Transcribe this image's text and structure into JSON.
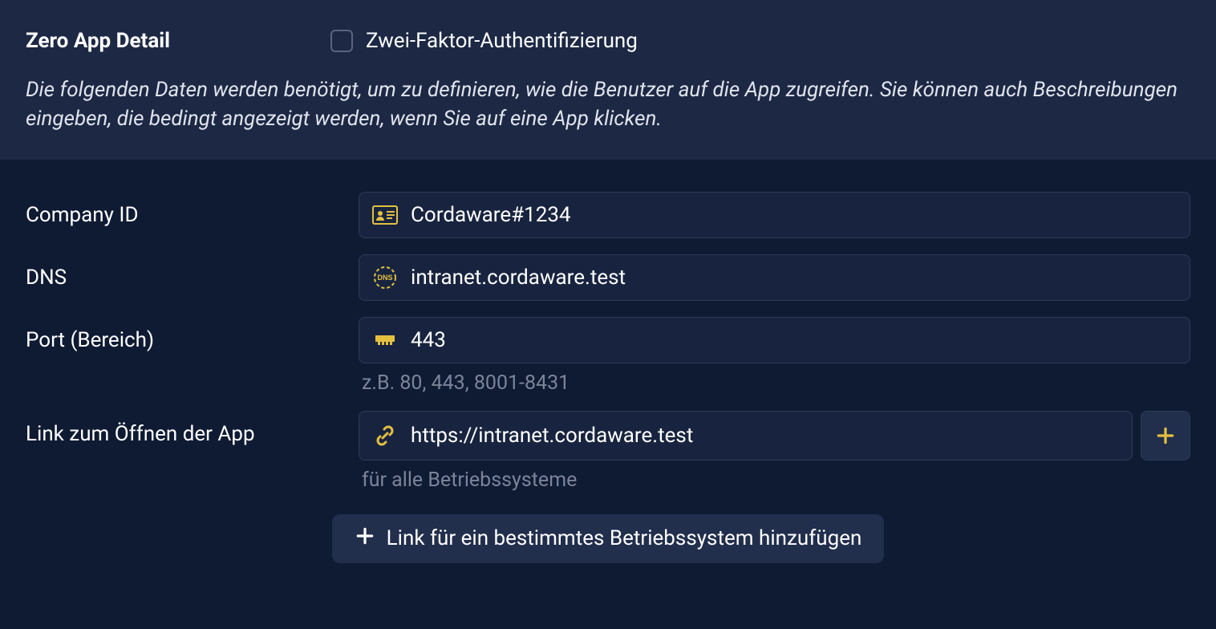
{
  "header": {
    "title": "Zero App Detail",
    "twofa_label": "Zwei-Faktor-Authentifizierung",
    "twofa_checked": false,
    "description": "Die folgenden Daten werden benötigt, um zu definieren, wie die Benutzer auf die App zugreifen. Sie können auch Beschreibungen eingeben, die bedingt angezeigt werden, wenn Sie auf eine App klicken."
  },
  "form": {
    "company_id": {
      "label": "Company ID",
      "value": "Cordaware#1234"
    },
    "dns": {
      "label": "DNS",
      "value": "intranet.cordaware.test"
    },
    "port": {
      "label": "Port (Bereich)",
      "value": "443",
      "hint": "z.B. 80, 443, 8001-8431"
    },
    "link": {
      "label": "Link zum Öffnen der App",
      "value": "https://intranet.cordaware.test",
      "hint": "für alle Betriebssysteme"
    },
    "add_os_button": "Link für ein bestimmtes Betriebssystem hinzufügen"
  },
  "colors": {
    "accent": "#e4c03f"
  }
}
